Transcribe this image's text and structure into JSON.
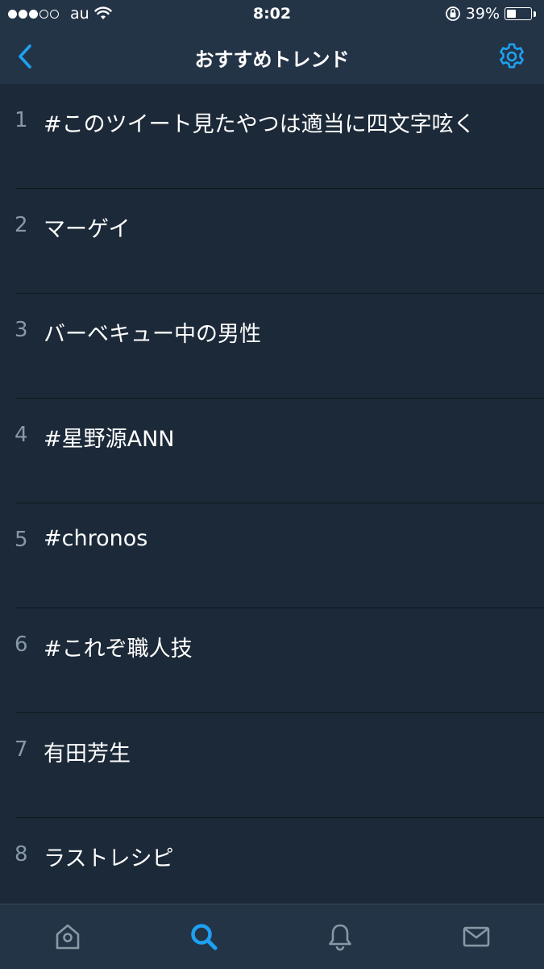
{
  "status_bar": {
    "signal": [
      "full",
      "full",
      "full",
      "empty",
      "empty"
    ],
    "carrier": "au",
    "time": "8:02",
    "battery_text": "39%",
    "battery_level": 0.39
  },
  "nav": {
    "title": "おすすめトレンド",
    "back_icon": "chevron-left-icon",
    "settings_icon": "gear-icon"
  },
  "trends": [
    {
      "rank": "1",
      "label": "#このツイート見たやつは適当に四文字呟く"
    },
    {
      "rank": "2",
      "label": "マーゲイ"
    },
    {
      "rank": "3",
      "label": "バーベキュー中の男性"
    },
    {
      "rank": "4",
      "label": "#星野源ANN"
    },
    {
      "rank": "5",
      "label": "#chronos"
    },
    {
      "rank": "6",
      "label": "#これぞ職人技"
    },
    {
      "rank": "7",
      "label": "有田芳生"
    },
    {
      "rank": "8",
      "label": "ラストレシピ"
    }
  ],
  "tabbar": {
    "tabs": [
      "home-icon",
      "search-icon",
      "bell-icon",
      "mail-icon"
    ],
    "active": "search-icon"
  },
  "colors": {
    "background": "#1c2938",
    "bar": "#243447",
    "accent": "#1da1f2",
    "muted": "#8899a6"
  }
}
